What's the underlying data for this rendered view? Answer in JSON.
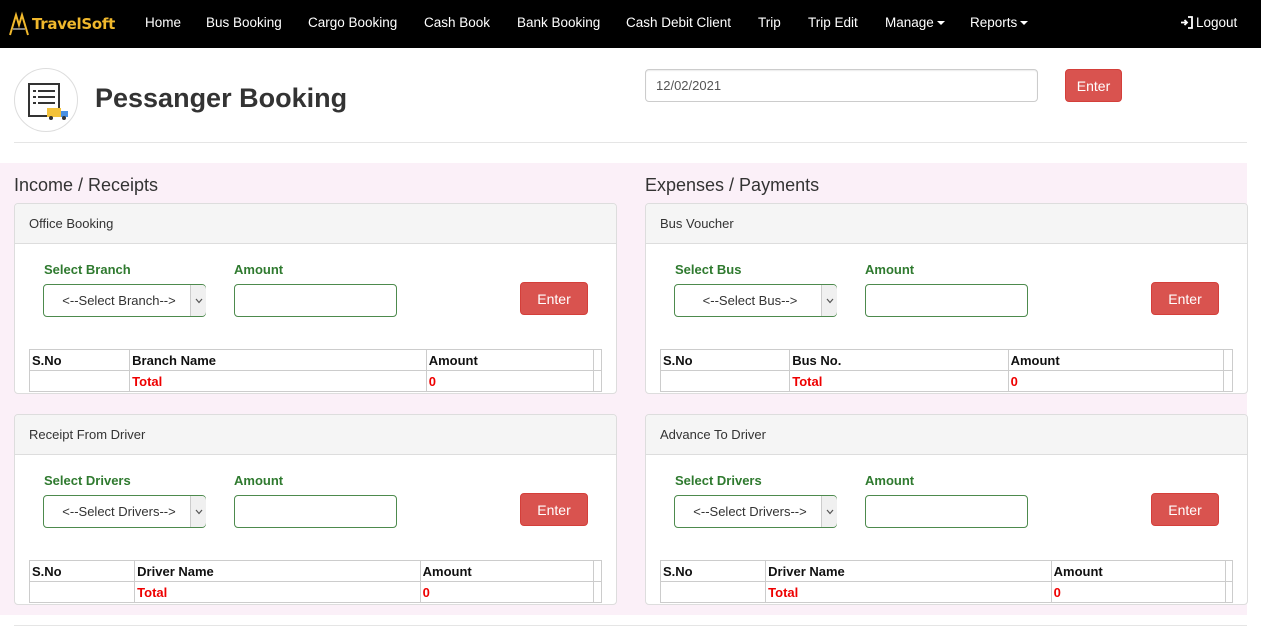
{
  "nav": {
    "brand": "TravelSoft",
    "items": [
      "Home",
      "Bus Booking",
      "Cargo Booking",
      "Cash Book",
      "Bank Booking",
      "Cash Debit Client",
      "Trip",
      "Trip Edit",
      "Manage",
      "Reports"
    ],
    "logout": "Logout"
  },
  "header": {
    "title": "Pessanger Booking",
    "date_value": "12/02/2021",
    "enter_label": "Enter"
  },
  "income": {
    "heading": "Income / Receipts",
    "office_booking": {
      "title": "Office Booking",
      "select_label": "Select Branch",
      "select_value": "<--Select Branch-->",
      "amount_label": "Amount",
      "enter_label": "Enter",
      "columns": [
        "S.No",
        "Branch Name",
        "Amount"
      ],
      "total_label": "Total",
      "total_value": "0"
    },
    "receipt_driver": {
      "title": "Receipt From Driver",
      "select_label": "Select Drivers",
      "select_value": "<--Select Drivers-->",
      "amount_label": "Amount",
      "enter_label": "Enter",
      "columns": [
        "S.No",
        "Driver Name",
        "Amount"
      ],
      "total_label": "Total",
      "total_value": "0"
    }
  },
  "expenses": {
    "heading": "Expenses / Payments",
    "bus_voucher": {
      "title": "Bus Voucher",
      "select_label": "Select Bus",
      "select_value": "<--Select Bus-->",
      "amount_label": "Amount",
      "enter_label": "Enter",
      "columns": [
        "S.No",
        "Bus No.",
        "Amount"
      ],
      "total_label": "Total",
      "total_value": "0"
    },
    "advance_driver": {
      "title": "Advance To Driver",
      "select_label": "Select Drivers",
      "select_value": "<--Select Drivers-->",
      "amount_label": "Amount",
      "enter_label": "Enter",
      "columns": [
        "S.No",
        "Driver Name",
        "Amount"
      ],
      "total_label": "Total",
      "total_value": "0"
    }
  },
  "colors": {
    "navbar": "#000000",
    "brand": "#f0b82c",
    "danger": "#d9534f",
    "label_green": "#2f7a2f",
    "total_red": "#ee0000",
    "section_bg": "#fbf0f8"
  }
}
